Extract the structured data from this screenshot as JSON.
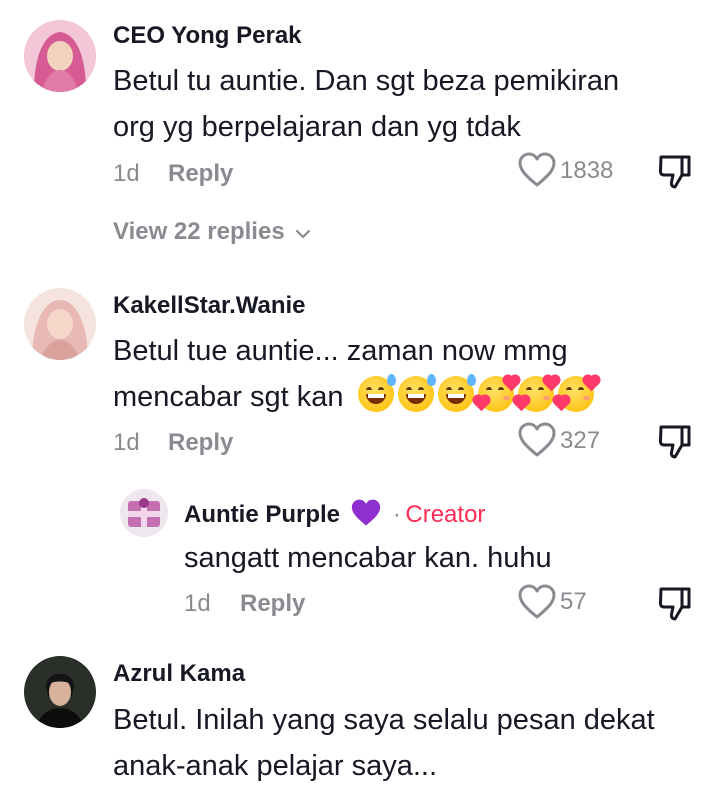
{
  "comments": [
    {
      "author": "CEO Yong Perak",
      "text_lines": [
        "Betul tu auntie. Dan sgt beza pemikiran",
        "org yg berpelajaran dan yg tdak"
      ],
      "time": "1d",
      "reply_label": "Reply",
      "likes": "1838",
      "view_replies": "View 22 replies"
    },
    {
      "author": "KakellStar.Wanie",
      "text_lines": [
        "Betul tue auntie... zaman now mmg",
        "mencabar sgt kan"
      ],
      "emojis": [
        "grinning-sweat-emoji",
        "grinning-sweat-emoji",
        "grinning-sweat-emoji",
        "smiling-hearts-emoji",
        "smiling-hearts-emoji",
        "smiling-hearts-emoji"
      ],
      "time": "1d",
      "reply_label": "Reply",
      "likes": "327"
    },
    {
      "author": "Azrul Kama",
      "text_lines": [
        "Betul. Inilah yang saya selalu pesan dekat",
        "anak-anak pelajar saya..."
      ]
    }
  ],
  "reply": {
    "author": "Auntie Purple",
    "badge": "Creator",
    "separator": "·",
    "heart_badge": "purple-heart-emoji",
    "text": "sangatt mencabar kan. huhu",
    "time": "1d",
    "reply_label": "Reply",
    "likes": "57"
  },
  "colors": {
    "text": "#161823",
    "muted": "#8a8b91",
    "creator": "#fe2c55",
    "purple_heart": "#8e2fd0"
  },
  "icons": {
    "like": "heart-outline-icon",
    "dislike": "thumbs-down-icon",
    "expand": "chevron-down-icon"
  }
}
